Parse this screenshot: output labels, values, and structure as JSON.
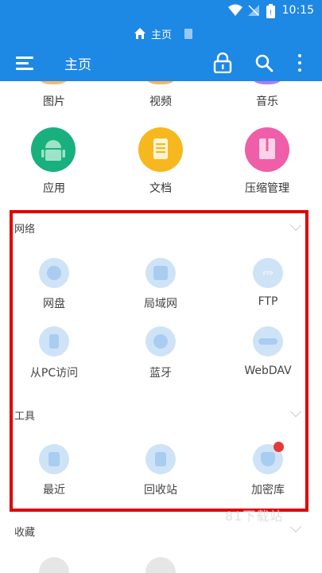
{
  "status_bar": {
    "time": "10:15"
  },
  "title_strip": {
    "label": "主页"
  },
  "app_bar": {
    "title": "主页"
  },
  "categories_top": [
    {
      "label": "图片",
      "color": "#f5a64b"
    },
    {
      "label": "视频",
      "color": "#f3a23a"
    },
    {
      "label": "音乐",
      "color": "#9c5cf5"
    }
  ],
  "categories": [
    {
      "label": "应用",
      "color": "#19b07d"
    },
    {
      "label": "文档",
      "color": "#f6b81e"
    },
    {
      "label": "压缩管理",
      "color": "#ef5ea8"
    }
  ],
  "network": {
    "title": "网络",
    "items": [
      {
        "label": "网盘",
        "icon": "cloud-drive-icon"
      },
      {
        "label": "局域网",
        "icon": "lan-icon"
      },
      {
        "label": "FTP",
        "icon": "ftp-icon"
      },
      {
        "label": "从PC访问",
        "icon": "pc-access-icon"
      },
      {
        "label": "蓝牙",
        "icon": "bluetooth-icon"
      },
      {
        "label": "WebDAV",
        "icon": "webdav-icon"
      }
    ]
  },
  "tools": {
    "title": "工具",
    "items": [
      {
        "label": "最近",
        "icon": "recent-icon"
      },
      {
        "label": "回收站",
        "icon": "recycle-bin-icon"
      },
      {
        "label": "加密库",
        "icon": "vault-icon"
      }
    ]
  },
  "favorites": {
    "title": "收藏"
  },
  "watermark": "81下载站",
  "colors": {
    "primary": "#1e88e5",
    "highlight_box": "#e00000",
    "icon_bg": "#cfe3f7"
  }
}
